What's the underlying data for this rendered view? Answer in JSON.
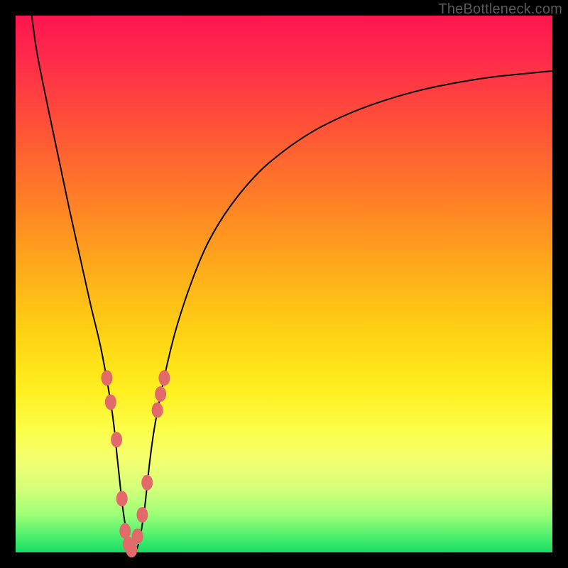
{
  "watermark": "TheBottleneck.com",
  "colors": {
    "background_frame": "#000000",
    "curve": "#000000",
    "marker": "#e26a6a",
    "gradient_top": "#ff154f",
    "gradient_bottom": "#18db66"
  },
  "chart_data": {
    "type": "line",
    "title": "",
    "xlabel": "",
    "ylabel": "",
    "xlim": [
      0,
      100
    ],
    "ylim": [
      0,
      100
    ],
    "series": [
      {
        "name": "bottleneck-curve",
        "x": [
          3,
          4,
          6,
          8,
          10,
          12,
          14,
          16,
          18,
          19,
          20,
          21,
          22,
          23,
          24,
          25,
          26,
          28,
          30,
          33,
          36,
          40,
          45,
          50,
          55,
          60,
          65,
          70,
          75,
          80,
          85,
          90,
          95,
          100
        ],
        "values": [
          100,
          93,
          83,
          73.5,
          64,
          55,
          46,
          37.5,
          26,
          17,
          8,
          2,
          0,
          2,
          8,
          17,
          24,
          34,
          42,
          51,
          58,
          64.5,
          70.5,
          74.8,
          78.2,
          80.8,
          82.9,
          84.6,
          86,
          87.1,
          88,
          88.7,
          89.2,
          89.7
        ]
      }
    ],
    "minimum_x": 22,
    "markers": {
      "name": "highlight-points",
      "x": [
        17.0,
        17.7,
        18.8,
        19.8,
        20.4,
        21.0,
        21.6,
        22.7,
        23.6,
        24.5,
        26.4,
        27.0,
        27.7
      ],
      "values": [
        32.5,
        28.0,
        21.0,
        10.0,
        4.0,
        1.5,
        0.5,
        3.0,
        7.0,
        13.0,
        26.5,
        29.5,
        32.5
      ]
    }
  }
}
